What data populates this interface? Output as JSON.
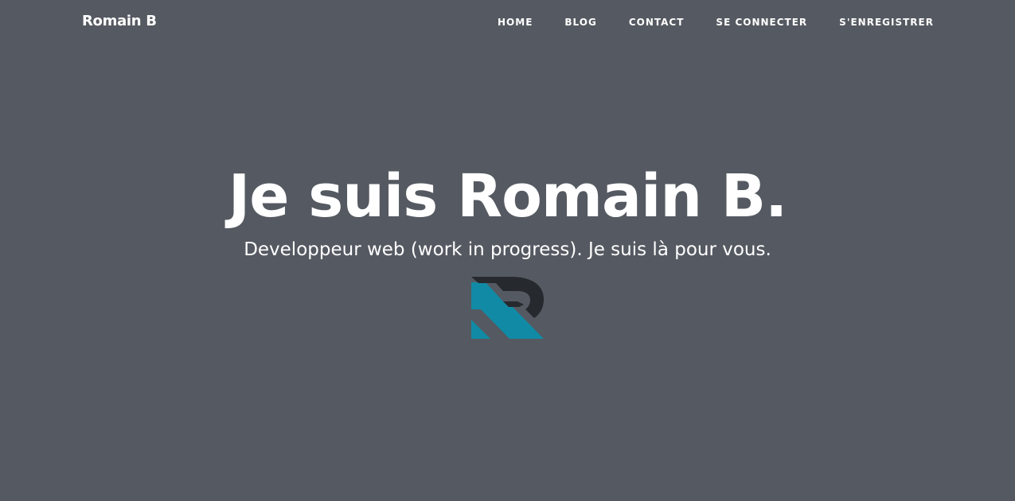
{
  "header": {
    "brand": "Romain B",
    "nav": [
      {
        "label": "HOME"
      },
      {
        "label": "BLOG"
      },
      {
        "label": "CONTACT"
      },
      {
        "label": "SE CONNECTER"
      },
      {
        "label": "S'ENREGISTRER"
      }
    ]
  },
  "hero": {
    "title": "Je suis Romain B.",
    "subtitle": "Developpeur web (work in progress). Je suis là pour vous."
  },
  "logo": {
    "icon": "r-monogram-icon",
    "colors": {
      "teal": "#118aa5",
      "dark": "#26292e"
    }
  },
  "colors": {
    "background": "#555961",
    "text": "#ffffff"
  }
}
